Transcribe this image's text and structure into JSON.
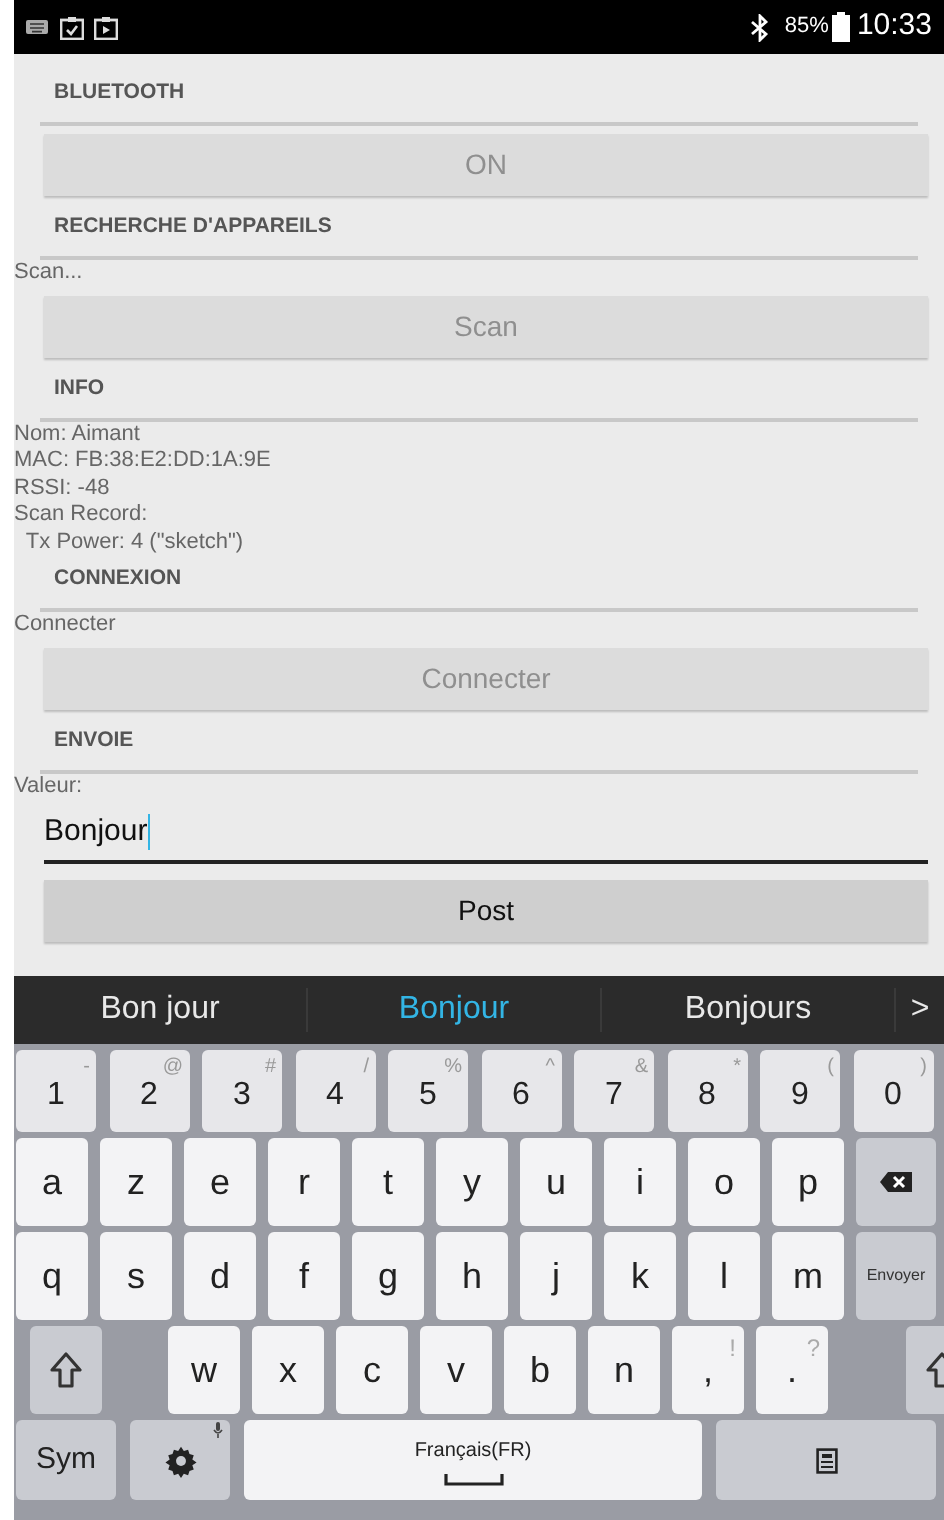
{
  "status_bar": {
    "battery": "85%",
    "time": "10:33"
  },
  "sections": [
    {
      "title": "BLUETOOTH",
      "items": [
        {
          "kind": "button",
          "label": "ON",
          "disabled": true
        }
      ]
    },
    {
      "title": "RECHERCHE D'APPAREILS",
      "items": [
        {
          "kind": "text",
          "lines": [
            "Scan..."
          ]
        },
        {
          "kind": "button",
          "label": "Scan",
          "disabled": true
        }
      ]
    },
    {
      "title": "INFO",
      "items": [
        {
          "kind": "text",
          "lines": [
            "Nom: Aimant",
            "MAC: FB:38:E2:DD:1A:9E",
            "RSSI: -48",
            "Scan Record:",
            "  Tx Power: 4 (\"sketch\")"
          ]
        }
      ]
    },
    {
      "title": "CONNEXION",
      "items": [
        {
          "kind": "text",
          "lines": [
            "Connecter"
          ]
        },
        {
          "kind": "button",
          "label": "Connecter",
          "disabled": true
        }
      ]
    },
    {
      "title": "ENVOIE",
      "items": [
        {
          "kind": "text",
          "lines": [
            "Valeur:"
          ]
        },
        {
          "kind": "field",
          "value": "Bonjour",
          "focused": true
        },
        {
          "kind": "button",
          "label": "Post",
          "disabled": false
        }
      ]
    }
  ],
  "suggestions": [
    {
      "text": "Bon jour",
      "selected": false
    },
    {
      "text": "Bonjour",
      "selected": true
    },
    {
      "text": "Bonjours",
      "selected": false
    },
    {
      "text": ">",
      "selected": false
    }
  ],
  "keyboard": {
    "number_keys": [
      {
        "kind": "num",
        "label": "1",
        "sub": "-"
      },
      {
        "kind": "num",
        "label": "2",
        "sub": "@"
      },
      {
        "kind": "num",
        "label": "3",
        "sub": "#"
      },
      {
        "kind": "num",
        "label": "4",
        "sub": "/"
      },
      {
        "kind": "num",
        "label": "5",
        "sub": "%"
      },
      {
        "kind": "num",
        "label": "6",
        "sub": "^"
      },
      {
        "kind": "num",
        "label": "7",
        "sub": "&"
      },
      {
        "kind": "num",
        "label": "8",
        "sub": "*"
      },
      {
        "kind": "num",
        "label": "9",
        "sub": "("
      },
      {
        "kind": "num",
        "label": "0",
        "sub": ")"
      }
    ],
    "top_letter_keys": [
      {
        "kind": "char",
        "label": "a"
      },
      {
        "kind": "char",
        "label": "z"
      },
      {
        "kind": "char",
        "label": "e"
      },
      {
        "kind": "char",
        "label": "r"
      },
      {
        "kind": "char",
        "label": "t"
      },
      {
        "kind": "char",
        "label": "y"
      },
      {
        "kind": "char",
        "label": "u"
      },
      {
        "kind": "char",
        "label": "i"
      },
      {
        "kind": "char",
        "label": "o"
      },
      {
        "kind": "char",
        "label": "p"
      },
      {
        "kind": "backspace"
      }
    ],
    "middle_letter_keys": [
      {
        "kind": "char",
        "label": "q"
      },
      {
        "kind": "char",
        "label": "s"
      },
      {
        "kind": "char",
        "label": "d"
      },
      {
        "kind": "char",
        "label": "f"
      },
      {
        "kind": "char",
        "label": "g"
      },
      {
        "kind": "char",
        "label": "h"
      },
      {
        "kind": "char",
        "label": "j"
      },
      {
        "kind": "char",
        "label": "k"
      },
      {
        "kind": "char",
        "label": "l"
      },
      {
        "kind": "char",
        "label": "m"
      },
      {
        "kind": "enter",
        "label": "Envoyer"
      }
    ],
    "bottom_letter_keys": [
      {
        "kind": "shift"
      },
      {
        "kind": "char",
        "label": "w"
      },
      {
        "kind": "char",
        "label": "x"
      },
      {
        "kind": "char",
        "label": "c"
      },
      {
        "kind": "char",
        "label": "v"
      },
      {
        "kind": "char",
        "label": "b"
      },
      {
        "kind": "char",
        "label": "n"
      },
      {
        "kind": "char",
        "label": ",",
        "sub": "!"
      },
      {
        "kind": "char",
        "label": ".",
        "sub": "?"
      },
      {
        "kind": "shift"
      }
    ],
    "function_keys": [
      {
        "kind": "sym",
        "label": "Sym"
      },
      {
        "kind": "settings"
      },
      {
        "kind": "space",
        "label": "Français(FR)"
      },
      {
        "kind": "clipboard"
      }
    ]
  }
}
